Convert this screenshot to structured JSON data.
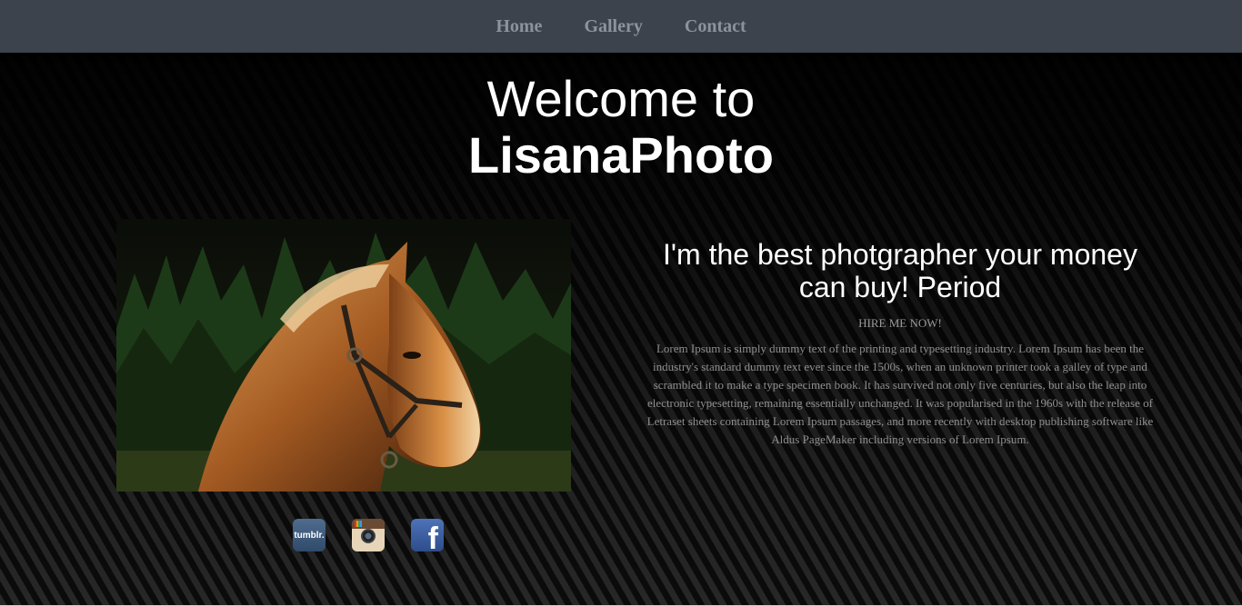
{
  "nav": {
    "items": [
      {
        "label": "Home"
      },
      {
        "label": "Gallery"
      },
      {
        "label": "Contact"
      }
    ]
  },
  "hero": {
    "line1": "Welcome to",
    "line2": "LisanaPhoto"
  },
  "about": {
    "heading": "I'm the best photgrapher your money can buy! Period",
    "cta": "HIRE ME NOW!",
    "body": "Lorem Ipsum is simply dummy text of the printing and typesetting industry. Lorem Ipsum has been the industry's standard dummy text ever since the 1500s, when an unknown printer took a galley of type and scrambled it to make a type specimen book. It has survived not only five centuries, but also the leap into electronic typesetting, remaining essentially unchanged. It was popularised in the 1960s with the release of Letraset sheets containing Lorem Ipsum passages, and more recently with desktop publishing software like Aldus PageMaker including versions of Lorem Ipsum."
  },
  "social": {
    "tumblr": {
      "icon": "tumblr-icon",
      "text": "tumblr."
    },
    "instagram": {
      "icon": "instagram-icon"
    },
    "facebook": {
      "icon": "facebook-icon",
      "text": "f"
    }
  },
  "colors": {
    "navbar": "#3c434d",
    "nav_text": "#8d939b",
    "background": "#000000"
  }
}
